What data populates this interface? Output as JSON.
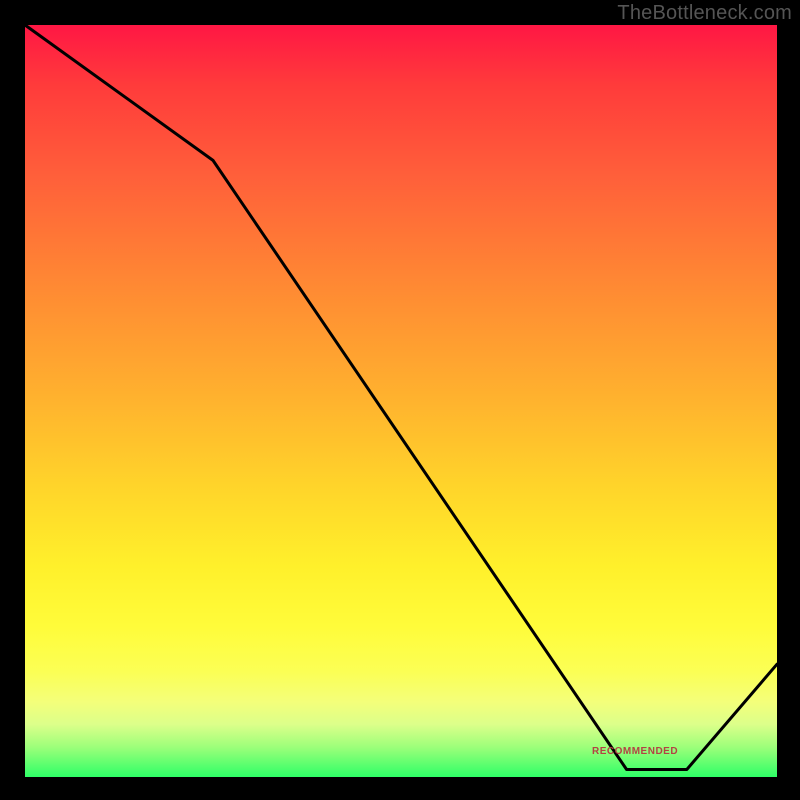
{
  "attribution": "TheBottleneck.com",
  "chart_data": {
    "type": "line",
    "title": "",
    "xlabel": "",
    "ylabel": "",
    "xlim": [
      0,
      100
    ],
    "ylim": [
      0,
      100
    ],
    "x": [
      0,
      25,
      80,
      88,
      100
    ],
    "values": [
      100,
      82,
      1,
      1,
      15
    ],
    "background_gradient": {
      "orientation": "vertical",
      "stops": [
        {
          "pos": 0,
          "color": "#ff1744"
        },
        {
          "pos": 50,
          "color": "#ffb32e"
        },
        {
          "pos": 80,
          "color": "#fffc3a"
        },
        {
          "pos": 100,
          "color": "#2eff67"
        }
      ]
    },
    "annotations": [
      {
        "id": "recommended",
        "text": "RECOMMENDED",
        "x": 80,
        "y": 3
      }
    ]
  },
  "colors": {
    "frame": "#000000",
    "line": "#000000",
    "attribution_text": "#555555",
    "annotation_text": "#b34343"
  }
}
